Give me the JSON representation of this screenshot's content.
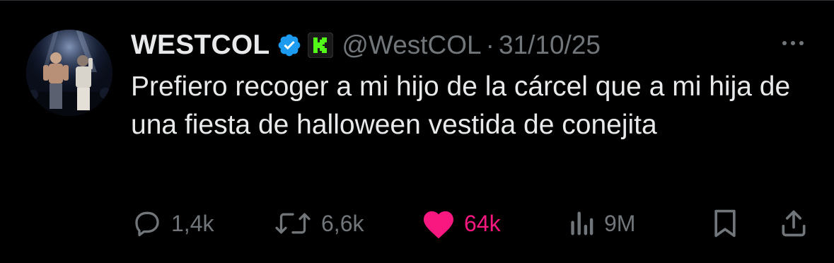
{
  "tweet": {
    "author": {
      "display_name": "WESTCOL",
      "handle": "@WestCOL",
      "verified_icon": "verified-badge-icon",
      "affiliate_icon": "kick-logo-icon"
    },
    "separator": "·",
    "date": "31/10/25",
    "text": "Prefiero recoger a mi hijo de la cárcel que a mi hija de una fiesta de halloween vestida de conejita",
    "actions": {
      "replies": "1,4k",
      "reposts": "6,6k",
      "likes": "64k",
      "views": "9M"
    }
  },
  "colors": {
    "background": "#000000",
    "text_primary": "#e7e9ea",
    "text_secondary": "#71767b",
    "verified_blue": "#1d9bf0",
    "kick_green": "#53fc18",
    "like_pink": "#f91880"
  }
}
